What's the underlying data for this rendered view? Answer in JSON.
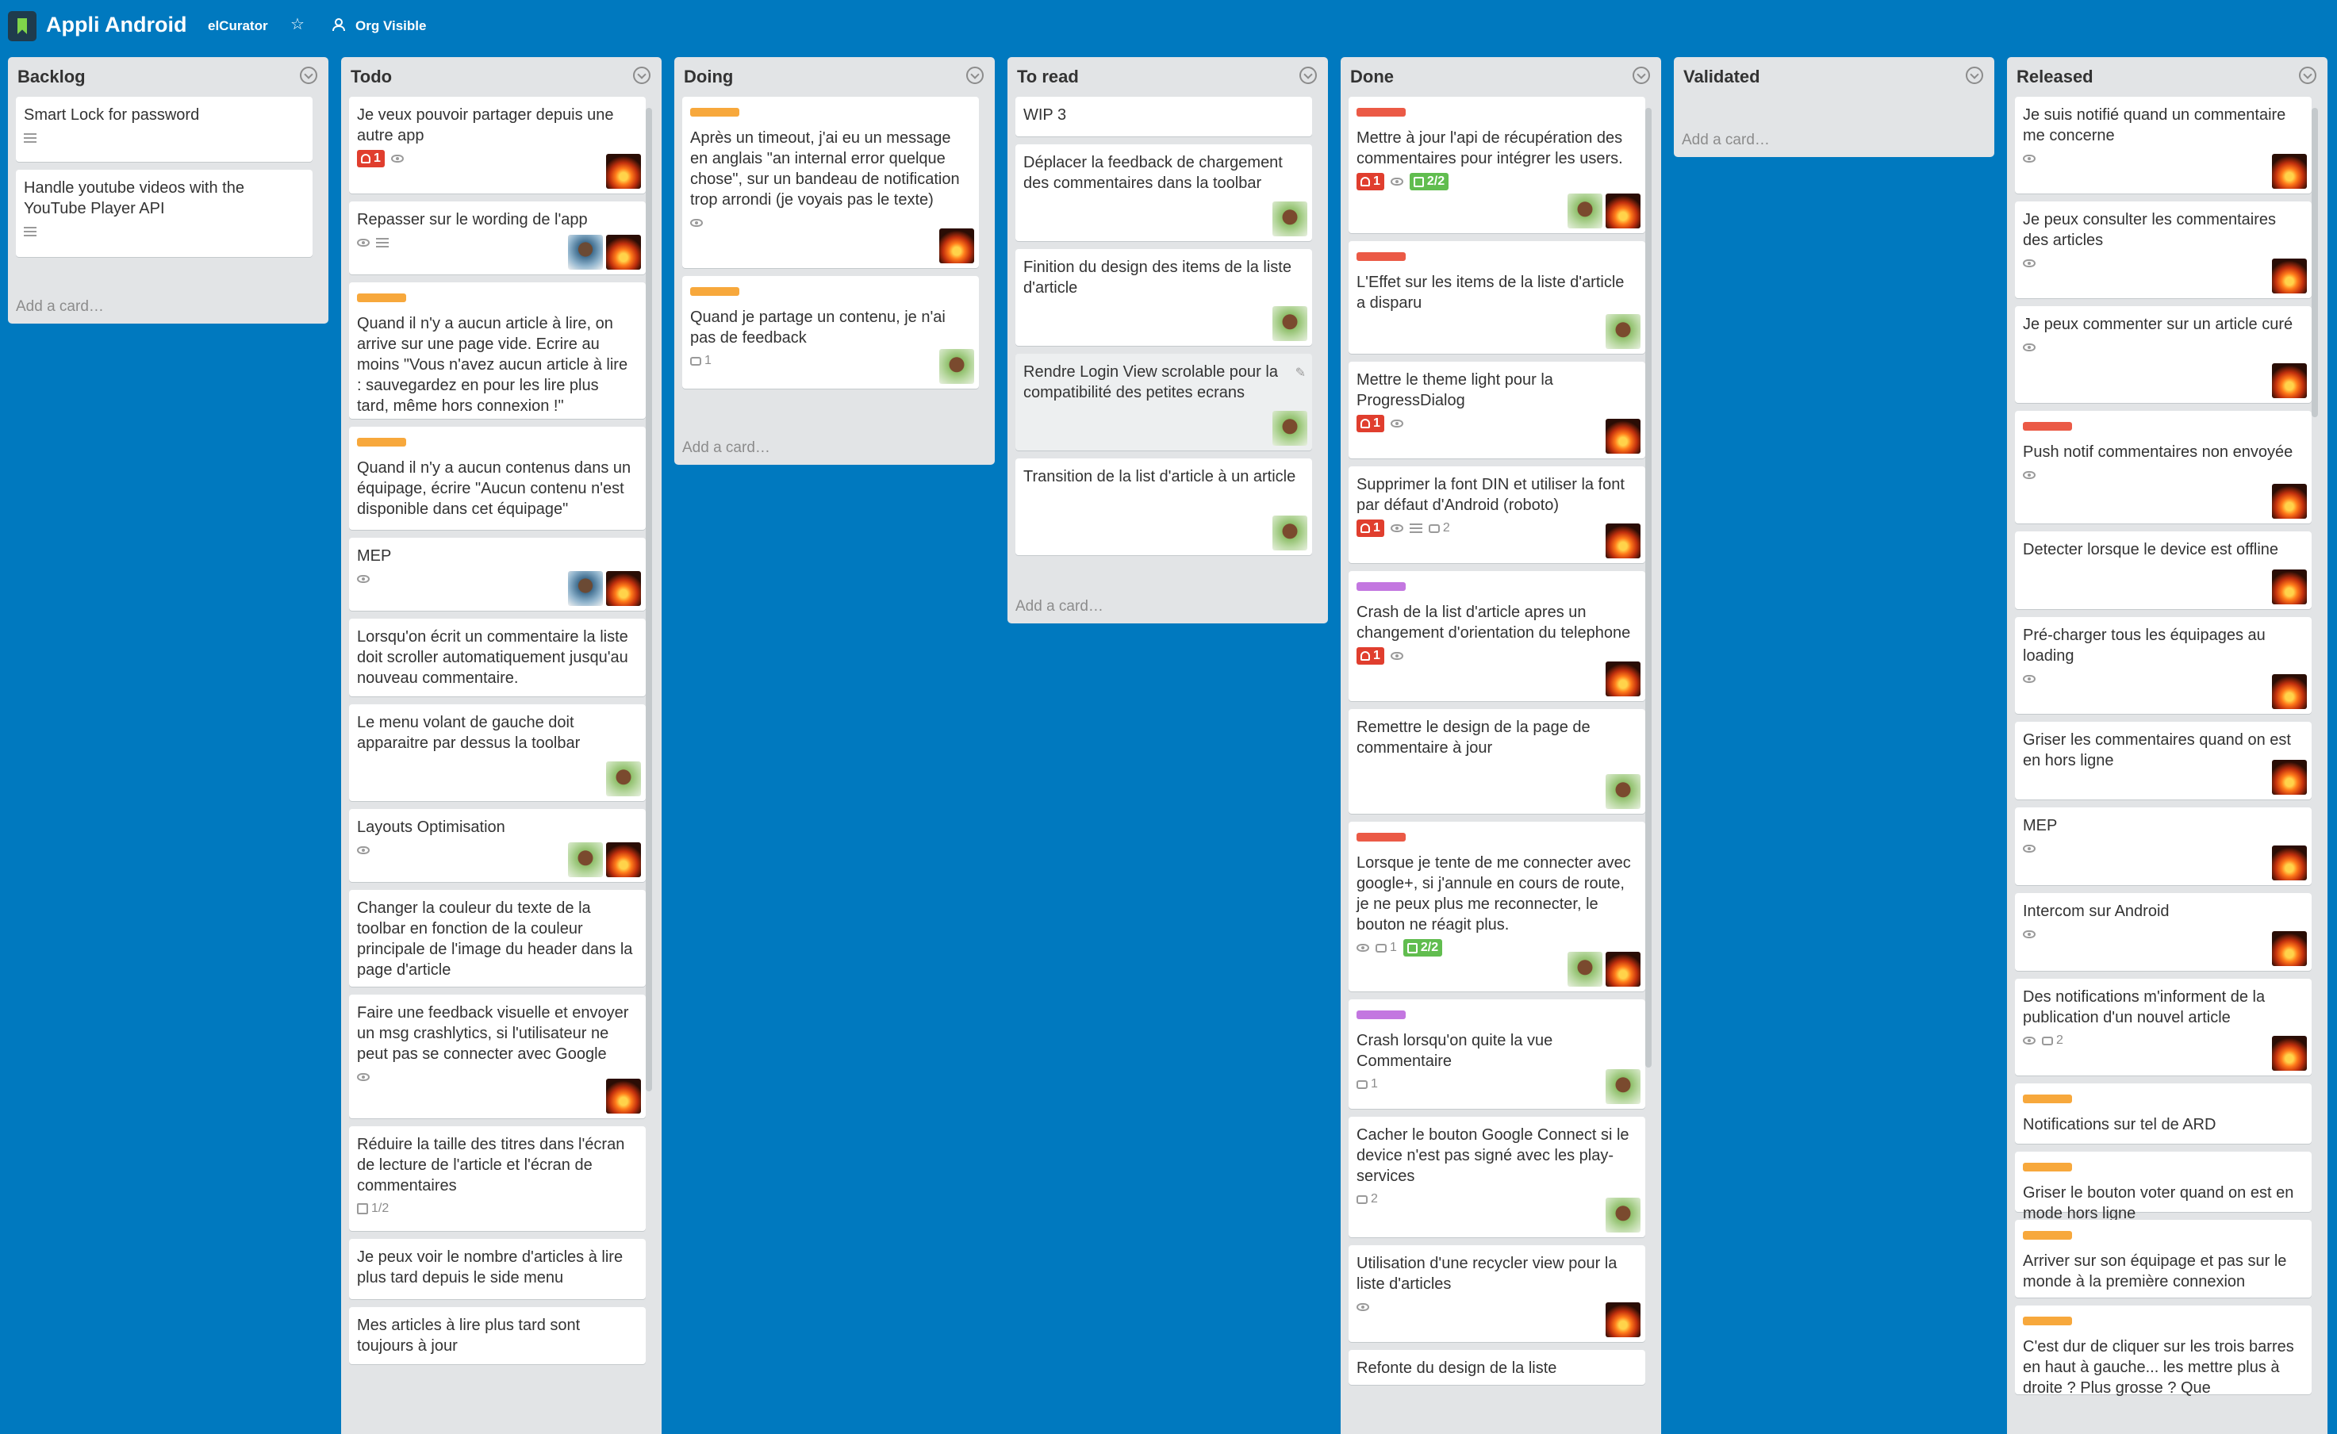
{
  "header": {
    "board_title": "Appli Android",
    "team_link": "elCurator",
    "visibility_label": "Org Visible",
    "star_icon": "star-icon"
  },
  "colors": {
    "board_bg": "#0079bf",
    "label_orange": "#f7a83c",
    "label_red": "#eb5a46",
    "label_purple": "#c377e0",
    "badge_due_red": "#e03e2e",
    "badge_check_green": "#61bd4f"
  },
  "lists": [
    {
      "title": "Backlog",
      "add_card": "Add a card…",
      "cards": [
        {
          "title": "Smart Lock for password",
          "description": true
        },
        {
          "title": "Handle youtube videos with the YouTube Player API",
          "description": true
        }
      ]
    },
    {
      "title": "Todo",
      "add_card": "Add a card…",
      "cards": [
        {
          "title": "Je veux pouvoir partager depuis une autre app",
          "due": "1",
          "watch": true,
          "members": [
            "fire"
          ]
        },
        {
          "title": "Repasser sur le wording de l'app",
          "watch": true,
          "description": true,
          "members": [
            "face2",
            "fire"
          ]
        },
        {
          "label": "orange",
          "title": "Quand il n'y a aucun article à lire, on arrive sur une page vide. Ecrire au moins \"Vous n'avez aucun article à lire : sauvegardez en pour les lire plus tard, même hors connexion !\""
        },
        {
          "label": "orange",
          "title": "Quand il n'y a aucun contenus dans un équipage, écrire \"Aucun contenu n'est disponible dans cet équipage\""
        },
        {
          "title": "MEP",
          "watch": true,
          "members": [
            "face2",
            "fire"
          ]
        },
        {
          "title": "Lorsqu'on écrit un commentaire la liste doit scroller automatiquement jusqu'au nouveau commentaire."
        },
        {
          "title": "Le menu volant de gauche doit apparaitre par dessus la toolbar",
          "members": [
            "face"
          ]
        },
        {
          "title": "Layouts Optimisation",
          "watch": true,
          "members": [
            "face",
            "fire"
          ]
        },
        {
          "title": "Changer la couleur du texte de la toolbar en fonction de la couleur principale de l'image du header dans la page d'article"
        },
        {
          "title": "Faire une feedback visuelle et envoyer un msg crashlytics, si l'utilisateur ne peut pas se connecter avec Google",
          "watch": true,
          "members": [
            "fire"
          ]
        },
        {
          "title": "Réduire la taille des titres dans l'écran de lecture de l'article et l'écran de commentaires",
          "checklist": "1/2"
        },
        {
          "title": "Je peux voir le nombre d'articles à lire plus tard depuis le side menu"
        },
        {
          "title": "Mes articles à lire plus tard sont toujours à jour"
        }
      ]
    },
    {
      "title": "Doing",
      "add_card": "Add a card…",
      "cards": [
        {
          "label": "orange",
          "title": "Après un timeout, j'ai eu un message en anglais \"an internal error quelque chose\", sur un bandeau de notification trop arrondi (je voyais pas le texte)",
          "watch": true,
          "members": [
            "fire"
          ]
        },
        {
          "label": "orange",
          "title": "Quand je partage un contenu, je n'ai pas de feedback",
          "comments": "1",
          "members": [
            "face"
          ]
        }
      ]
    },
    {
      "title": "To read",
      "add_card": "Add a card…",
      "cards": [
        {
          "title": "WIP 3"
        },
        {
          "title": "Déplacer la feedback de chargement des commentaires dans la toolbar",
          "members": [
            "face"
          ]
        },
        {
          "title": "Finition du design des items de la liste d'article",
          "members": [
            "face"
          ]
        },
        {
          "title": "Rendre Login View scrolable pour la compatibilité des petites ecrans",
          "members": [
            "face"
          ]
        },
        {
          "title": "Transition de la list d'article à un article",
          "members": [
            "face"
          ]
        }
      ]
    },
    {
      "title": "Done",
      "add_card": "Add a card…",
      "cards": [
        {
          "label": "red",
          "title": "Mettre à jour l'api de récupération des commentaires pour intégrer les users.",
          "due": "1",
          "watch": true,
          "check": "2/2",
          "members": [
            "face",
            "fire"
          ]
        },
        {
          "label": "red",
          "title": "L'Effet sur les items de la liste d'article a disparu",
          "members": [
            "face"
          ]
        },
        {
          "title": "Mettre le theme light pour la ProgressDialog",
          "due": "1",
          "watch": true,
          "members": [
            "fire"
          ]
        },
        {
          "title": "Supprimer la font DIN et utiliser la font par défaut d'Android (roboto)",
          "due": "1",
          "watch": true,
          "description": true,
          "comments": "2",
          "members": [
            "fire"
          ]
        },
        {
          "label": "purple",
          "title": "Crash de la list d'article apres un changement d'orientation du telephone",
          "due": "1",
          "watch": true,
          "members": [
            "fire"
          ]
        },
        {
          "title": "Remettre le design de la page de commentaire à jour",
          "members": [
            "face"
          ]
        },
        {
          "label": "red",
          "title": "Lorsque je tente de me connecter avec google+, si j'annule en cours de route, je ne peux plus me reconnecter, le bouton ne réagit plus.",
          "watch": true,
          "comments": "1",
          "check": "2/2",
          "members": [
            "face",
            "fire"
          ]
        },
        {
          "label": "purple",
          "title": "Crash lorsqu'on quite la vue Commentaire",
          "comments": "1",
          "members": [
            "face"
          ]
        },
        {
          "title": "Cacher le bouton Google Connect si le device n'est pas signé avec les play-services",
          "comments": "2",
          "members": [
            "face"
          ]
        },
        {
          "title": "Utilisation d'une recycler view pour la liste d'articles",
          "watch": true,
          "members": [
            "fire"
          ]
        },
        {
          "title": "Refonte du design de la liste"
        }
      ]
    },
    {
      "title": "Validated",
      "add_card": "Add a card…",
      "cards": []
    },
    {
      "title": "Released",
      "add_card": "Add a card…",
      "cards": [
        {
          "title": "Je suis notifié quand un commentaire me concerne",
          "watch": true,
          "members": [
            "fire"
          ]
        },
        {
          "title": "Je peux consulter les commentaires des articles",
          "watch": true,
          "members": [
            "fire"
          ]
        },
        {
          "title": "Je peux commenter sur un article curé",
          "watch": true,
          "members": [
            "fire"
          ]
        },
        {
          "label": "red",
          "title": "Push notif commentaires non envoyée",
          "watch": true,
          "members": [
            "fire"
          ]
        },
        {
          "title": "Detecter lorsque le device est offline",
          "members": [
            "fire"
          ]
        },
        {
          "title": "Pré-charger tous les équipages au loading",
          "watch": true,
          "members": [
            "fire"
          ]
        },
        {
          "title": "Griser les commentaires quand on est en hors ligne",
          "members": [
            "fire"
          ]
        },
        {
          "title": "MEP",
          "watch": true,
          "members": [
            "fire"
          ]
        },
        {
          "title": "Intercom sur Android",
          "watch": true,
          "members": [
            "fire"
          ]
        },
        {
          "title": "Des notifications m'informent de la publication d'un nouvel article",
          "watch": true,
          "comments": "2",
          "members": [
            "fire"
          ]
        },
        {
          "label": "orange",
          "title": "Notifications sur tel de ARD"
        },
        {
          "label": "orange",
          "title": "Griser le bouton voter quand on est en mode hors ligne"
        },
        {
          "label": "orange",
          "title": "Arriver sur son équipage et pas sur le monde à la première connexion"
        },
        {
          "label": "orange",
          "title": "C'est dur de cliquer sur les trois barres en haut à gauche... les mettre plus à droite ? Plus grosse ? Que"
        }
      ]
    }
  ]
}
